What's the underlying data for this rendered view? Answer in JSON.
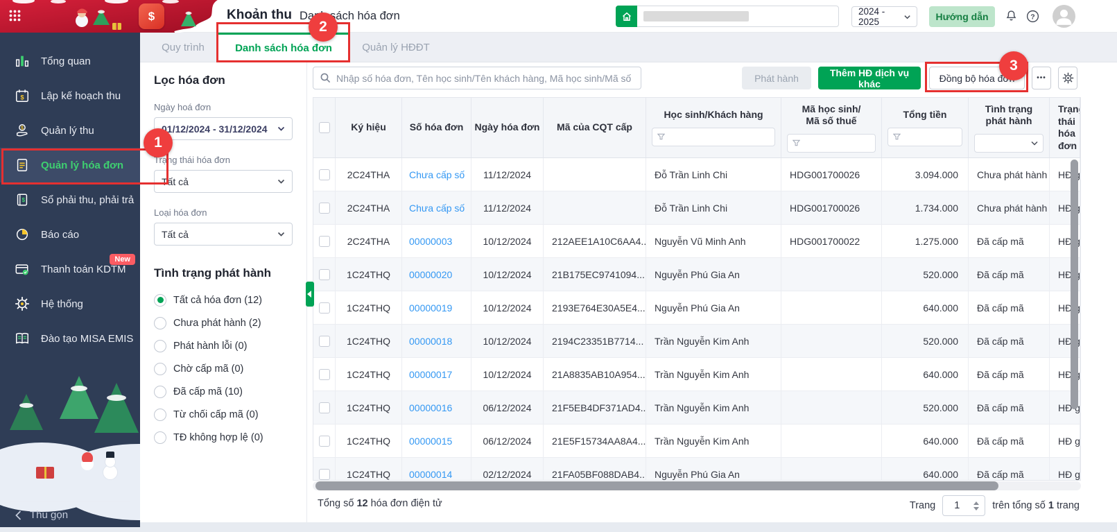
{
  "header": {
    "app_title": "Khoản thu",
    "page_title": "Danh sách hóa đơn",
    "year_value": "2024 - 2025",
    "guide_label": "Hướng dẫn",
    "icons": [
      "app-grid-icon",
      "app-logo",
      "home-icon",
      "bell-icon",
      "help-icon",
      "avatar"
    ]
  },
  "tabs": [
    {
      "label": "Quy trình",
      "active": false
    },
    {
      "label": "Danh sách hóa đơn",
      "active": true
    },
    {
      "label": "Quản lý HĐĐT",
      "active": false
    }
  ],
  "sidebar": {
    "items": [
      {
        "label": "Tổng quan",
        "icon": "bar-chart-icon",
        "active": false
      },
      {
        "label": "Lập kế hoạch thu",
        "icon": "calendar-dollar-icon",
        "active": false
      },
      {
        "label": "Quản lý thu",
        "icon": "hand-coin-icon",
        "active": false
      },
      {
        "label": "Quản lý hóa đơn",
        "icon": "invoice-icon",
        "active": true
      },
      {
        "label": "Sổ phải thu, phải trả",
        "icon": "ledger-icon",
        "active": false
      },
      {
        "label": "Báo cáo",
        "icon": "pie-chart-icon",
        "active": false
      },
      {
        "label": "Thanh toán KDTM",
        "icon": "card-check-icon",
        "active": false,
        "badge": "New"
      },
      {
        "label": "Hệ thống",
        "icon": "gear-icon",
        "active": false
      },
      {
        "label": "Đào tạo MISA EMIS",
        "icon": "open-book-icon",
        "active": false
      }
    ],
    "collapse_label": "Thu gọn"
  },
  "filters": {
    "title": "Lọc hóa đơn",
    "date_label": "Ngày hoá đơn",
    "date_value": "01/12/2024 - 31/12/2024",
    "status_label": "Trạng thái hóa đơn",
    "status_value": "Tất cả",
    "type_label": "Loại hóa đơn",
    "type_value": "Tất cả",
    "issue_title": "Tình trạng phát hành",
    "issue_options": [
      {
        "label": "Tất cả hóa đơn (12)",
        "selected": true
      },
      {
        "label": "Chưa phát hành (2)",
        "selected": false
      },
      {
        "label": "Phát hành lỗi (0)",
        "selected": false
      },
      {
        "label": "Chờ cấp mã (0)",
        "selected": false
      },
      {
        "label": "Đã cấp mã (10)",
        "selected": false
      },
      {
        "label": "Từ chối cấp mã (0)",
        "selected": false
      },
      {
        "label": "TĐ không hợp lệ (0)",
        "selected": false
      }
    ]
  },
  "toolbar": {
    "search_placeholder": "Nhập số hóa đơn, Tên học sinh/Tên khách hàng, Mã học sinh/Mã số thuế",
    "issue_label": "Phát hành",
    "add_label": "Thêm HĐ dịch vụ khác",
    "sync_label": "Đồng bộ hóa đơn",
    "more_label": "•••"
  },
  "table": {
    "columns": [
      "",
      "Ký hiệu",
      "Số hóa đơn",
      "Ngày hóa đơn",
      "Mã của CQT cấp",
      "Học sinh/Khách hàng",
      "Mã học sinh/\nMã số thuế",
      "Tổng tiền",
      "Tình trạng\nphát hành",
      "Trạng thái\nhóa đơn"
    ],
    "rows": [
      {
        "ky_hieu": "2C24THA",
        "so": "Chưa cấp số",
        "ngay": "11/12/2024",
        "ma_cqt": "",
        "hoc_sinh": "Đỗ Trần Linh Chi",
        "ma_hs": "HDG001700026",
        "tong_tien": "3.094.000",
        "tinh_trang": "Chưa phát hành",
        "trang_thai": "HĐ gốc"
      },
      {
        "ky_hieu": "2C24THA",
        "so": "Chưa cấp số",
        "ngay": "11/12/2024",
        "ma_cqt": "",
        "hoc_sinh": "Đỗ Trần Linh Chi",
        "ma_hs": "HDG001700026",
        "tong_tien": "1.734.000",
        "tinh_trang": "Chưa phát hành",
        "trang_thai": "HĐ gốc"
      },
      {
        "ky_hieu": "2C24THA",
        "so": "00000003",
        "ngay": "10/12/2024",
        "ma_cqt": "212AEE1A10C6AA4...",
        "hoc_sinh": "Nguyễn Vũ Minh Anh",
        "ma_hs": "HDG001700022",
        "tong_tien": "1.275.000",
        "tinh_trang": "Đã cấp mã",
        "trang_thai": "HĐ gốc"
      },
      {
        "ky_hieu": "1C24THQ",
        "so": "00000020",
        "ngay": "10/12/2024",
        "ma_cqt": "21B175EC9741094...",
        "hoc_sinh": "Nguyễn Phú Gia An",
        "ma_hs": "",
        "tong_tien": "520.000",
        "tinh_trang": "Đã cấp mã",
        "trang_thai": "HĐ gốc"
      },
      {
        "ky_hieu": "1C24THQ",
        "so": "00000019",
        "ngay": "10/12/2024",
        "ma_cqt": "2193E764E30A5E4...",
        "hoc_sinh": "Nguyễn Phú Gia An",
        "ma_hs": "",
        "tong_tien": "640.000",
        "tinh_trang": "Đã cấp mã",
        "trang_thai": "HĐ gốc"
      },
      {
        "ky_hieu": "1C24THQ",
        "so": "00000018",
        "ngay": "10/12/2024",
        "ma_cqt": "2194C23351B7714...",
        "hoc_sinh": "Trần Nguyễn Kim Anh",
        "ma_hs": "",
        "tong_tien": "520.000",
        "tinh_trang": "Đã cấp mã",
        "trang_thai": "HĐ gốc"
      },
      {
        "ky_hieu": "1C24THQ",
        "so": "00000017",
        "ngay": "10/12/2024",
        "ma_cqt": "21A8835AB10A954...",
        "hoc_sinh": "Trần Nguyễn Kim Anh",
        "ma_hs": "",
        "tong_tien": "640.000",
        "tinh_trang": "Đã cấp mã",
        "trang_thai": "HĐ gốc"
      },
      {
        "ky_hieu": "1C24THQ",
        "so": "00000016",
        "ngay": "06/12/2024",
        "ma_cqt": "21F5EB4DF371AD4...",
        "hoc_sinh": "Trần Nguyễn Kim Anh",
        "ma_hs": "",
        "tong_tien": "520.000",
        "tinh_trang": "Đã cấp mã",
        "trang_thai": "HĐ gốc"
      },
      {
        "ky_hieu": "1C24THQ",
        "so": "00000015",
        "ngay": "06/12/2024",
        "ma_cqt": "21E5F15734AA8A4...",
        "hoc_sinh": "Trần Nguyễn Kim Anh",
        "ma_hs": "",
        "tong_tien": "640.000",
        "tinh_trang": "Đã cấp mã",
        "trang_thai": "HĐ gốc"
      },
      {
        "ky_hieu": "1C24THQ",
        "so": "00000014",
        "ngay": "02/12/2024",
        "ma_cqt": "21FA05BF088DAB4...",
        "hoc_sinh": "Nguyễn Phú Gia An",
        "ma_hs": "",
        "tong_tien": "640.000",
        "tinh_trang": "Đã cấp mã",
        "trang_thai": "HĐ gốc"
      }
    ]
  },
  "footer": {
    "total_prefix": "Tổng số",
    "total_count": "12",
    "total_suffix": "hóa đơn điện tử",
    "page_label": "Trang",
    "page_value": "1",
    "page_total_prefix": "trên tổng số",
    "page_total": "1",
    "page_total_suffix": "trang"
  },
  "annotations": {
    "step1": "1",
    "step2": "2",
    "step3": "3"
  },
  "colors": {
    "primary_green": "#00a355",
    "annotation_red": "#e53030",
    "link_blue": "#3498f3",
    "sidebar_bg": "#2f3d56",
    "sidebar_active_text": "#3ecf70",
    "banner_red": "#c01830",
    "guide_bg": "#bde5cb",
    "guide_text": "#157f42"
  }
}
